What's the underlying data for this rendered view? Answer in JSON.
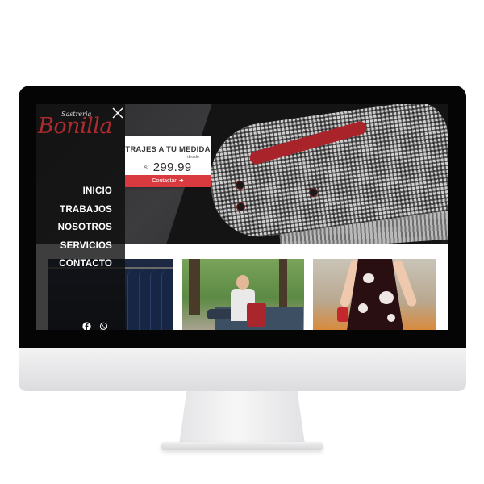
{
  "sidebar": {
    "logo": {
      "small_text": "Sastreria",
      "script_text": "Bonilla"
    },
    "menu": [
      {
        "label": "INICIO",
        "name": "menu-item-inicio"
      },
      {
        "label": "TRABAJOS",
        "name": "menu-item-trabajos"
      },
      {
        "label": "NOSOTROS",
        "name": "menu-item-nosotros"
      },
      {
        "label": "SERVICIOS",
        "name": "menu-item-servicios"
      },
      {
        "label": "CONTACTO",
        "name": "menu-item-contacto"
      }
    ],
    "social_icons": [
      "facebook-icon",
      "whatsapp-icon"
    ],
    "close_icon": "close-icon"
  },
  "promo": {
    "title": "TRAJES A TU MEDIDA",
    "desde": "desde",
    "currency": "S/",
    "price": "299.99",
    "button_label": "Contactar",
    "button_icon": "arrow-right-icon"
  },
  "gallery": {
    "tiles": [
      "suits-photo",
      "portrait-photo",
      "dress-photo"
    ]
  },
  "colors": {
    "accent_red": "#d83a3f",
    "logo_red": "#ad2a2f",
    "menu_bg": "#0e0e0e"
  }
}
